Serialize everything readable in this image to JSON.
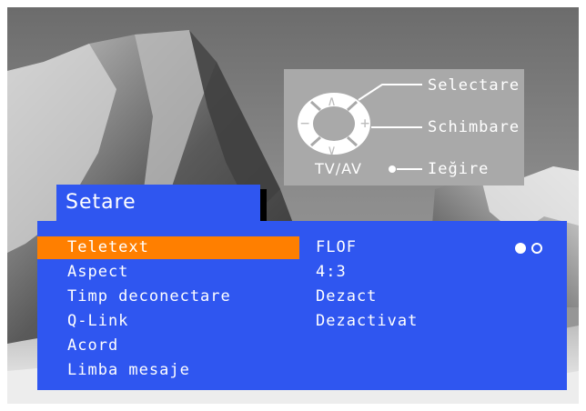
{
  "remote_help": {
    "select_label": "Selectare",
    "change_label": "Schimbare",
    "exit_label": "Ieğire",
    "tv_av_label": "TV/AV",
    "up_symbol": "∧",
    "down_symbol": "∨",
    "minus_symbol": "−",
    "plus_symbol": "+"
  },
  "menu": {
    "title": "Setare",
    "items": [
      {
        "label": "Teletext",
        "value": "FLOF",
        "selected": true
      },
      {
        "label": "Aspect",
        "value": "4:3"
      },
      {
        "label": "Timp deconectare",
        "value": "Dezact"
      },
      {
        "label": "Q-Link",
        "value": "Dezactivat"
      },
      {
        "label": "Acord",
        "value": ""
      },
      {
        "label": "Limba mesaje",
        "value": ""
      }
    ]
  },
  "colors": {
    "menu_bg": "#2f56f0",
    "selection": "#ff7f00",
    "help_panel": "#a9a9a9"
  }
}
